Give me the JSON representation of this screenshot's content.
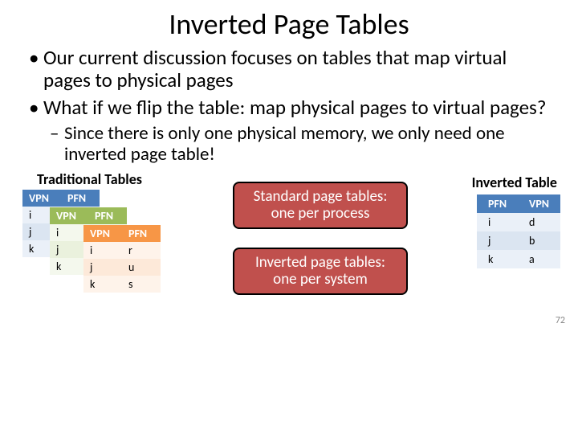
{
  "title": "Inverted Page Tables",
  "bullets": {
    "b1": "Our current discussion focuses on tables that map virtual pages to physical pages",
    "b2": "What if we flip the table: map physical pages to virtual pages?",
    "s1": "Since there is only one physical memory, we only need one inverted page table!"
  },
  "labels": {
    "traditional": "Traditional Tables",
    "inverted": "Inverted Table"
  },
  "cols": {
    "vpn": "VPN",
    "pfn": "PFN"
  },
  "trad": {
    "t1": {
      "rows": [
        "i",
        "j",
        "k"
      ]
    },
    "t2": {
      "rows": [
        "i",
        "j",
        "k"
      ]
    },
    "t3": {
      "vpn": [
        "i",
        "j",
        "k"
      ],
      "pfn": [
        "r",
        "u",
        "s"
      ]
    }
  },
  "callouts": {
    "c1a": "Standard page tables:",
    "c1b": "one per process",
    "c2a": "Inverted page tables:",
    "c2b": "one per system"
  },
  "inverted": {
    "pfn": [
      "i",
      "j",
      "k"
    ],
    "vpn": [
      "d",
      "b",
      "a"
    ]
  },
  "pagenum": "72"
}
